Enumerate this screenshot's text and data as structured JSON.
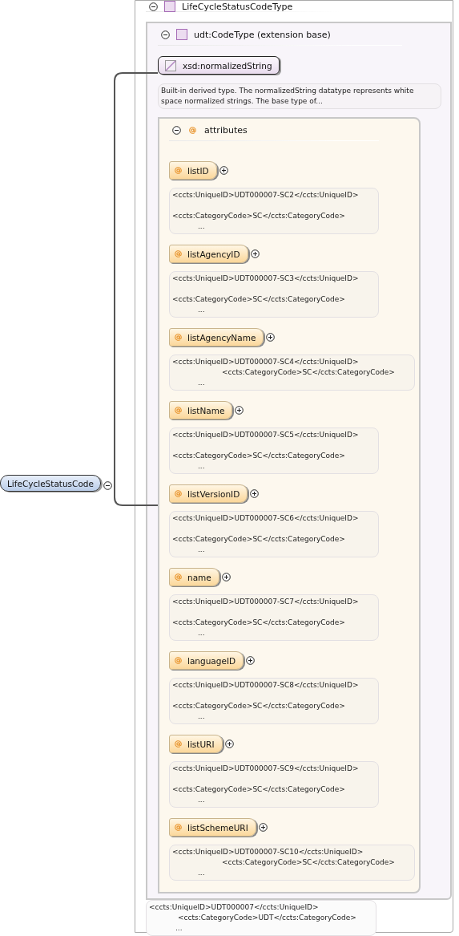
{
  "element": {
    "name": "LifeCycleStatusCode",
    "expanded": true
  },
  "type": {
    "name": "LifeCycleStatusCodeType",
    "expanded": true,
    "extension": {
      "name": "udt:CodeType (extension base)",
      "expanded": true,
      "base_type": {
        "name": "xsd:normalizedString",
        "doc": "Built-in derived type. The normalizedString datatype represents white space normalized strings. The base type of..."
      },
      "attributes": {
        "label": "attributes",
        "expanded": true,
        "items": [
          {
            "name": "listID",
            "expanded": false,
            "doc": {
              "kind": "gap",
              "lines": [
                "<ccts:UniqueID>UDT000007-SC2</ccts:UniqueID>",
                "<ccts:CategoryCode>SC</ccts:CategoryCode>",
                "..."
              ]
            }
          },
          {
            "name": "listAgencyID",
            "expanded": false,
            "doc": {
              "kind": "gap",
              "lines": [
                "<ccts:UniqueID>UDT000007-SC3</ccts:UniqueID>",
                "<ccts:CategoryCode>SC</ccts:CategoryCode>",
                "..."
              ]
            }
          },
          {
            "name": "listAgencyName",
            "expanded": false,
            "doc": {
              "kind": "wide_indent",
              "lines": [
                "<ccts:UniqueID>UDT000007-SC4</ccts:UniqueID>",
                "<ccts:CategoryCode>SC</ccts:CategoryCode>",
                "..."
              ]
            }
          },
          {
            "name": "listName",
            "expanded": false,
            "doc": {
              "kind": "gap",
              "lines": [
                "<ccts:UniqueID>UDT000007-SC5</ccts:UniqueID>",
                "<ccts:CategoryCode>SC</ccts:CategoryCode>",
                "..."
              ]
            }
          },
          {
            "name": "listVersionID",
            "expanded": false,
            "doc": {
              "kind": "gap",
              "lines": [
                "<ccts:UniqueID>UDT000007-SC6</ccts:UniqueID>",
                "<ccts:CategoryCode>SC</ccts:CategoryCode>",
                "..."
              ]
            }
          },
          {
            "name": "name",
            "expanded": false,
            "doc": {
              "kind": "gap",
              "lines": [
                "<ccts:UniqueID>UDT000007-SC7</ccts:UniqueID>",
                "<ccts:CategoryCode>SC</ccts:CategoryCode>",
                "..."
              ]
            }
          },
          {
            "name": "languageID",
            "expanded": false,
            "doc": {
              "kind": "gap",
              "lines": [
                "<ccts:UniqueID>UDT000007-SC8</ccts:UniqueID>",
                "<ccts:CategoryCode>SC</ccts:CategoryCode>",
                "..."
              ]
            }
          },
          {
            "name": "listURI",
            "expanded": false,
            "doc": {
              "kind": "gap",
              "lines": [
                "<ccts:UniqueID>UDT000007-SC9</ccts:UniqueID>",
                "<ccts:CategoryCode>SC</ccts:CategoryCode>",
                "..."
              ]
            }
          },
          {
            "name": "listSchemeURI",
            "expanded": false,
            "doc": {
              "kind": "wide_indent",
              "lines": [
                "<ccts:UniqueID>UDT000007-SC10</ccts:UniqueID>",
                "<ccts:CategoryCode>SC</ccts:CategoryCode>",
                "..."
              ]
            }
          }
        ]
      }
    },
    "doc": {
      "kind": "narrow_indent",
      "lines": [
        "<ccts:UniqueID>UDT000007</ccts:UniqueID>",
        "<ccts:CategoryCode>UDT</ccts:CategoryCode>",
        "..."
      ]
    }
  }
}
